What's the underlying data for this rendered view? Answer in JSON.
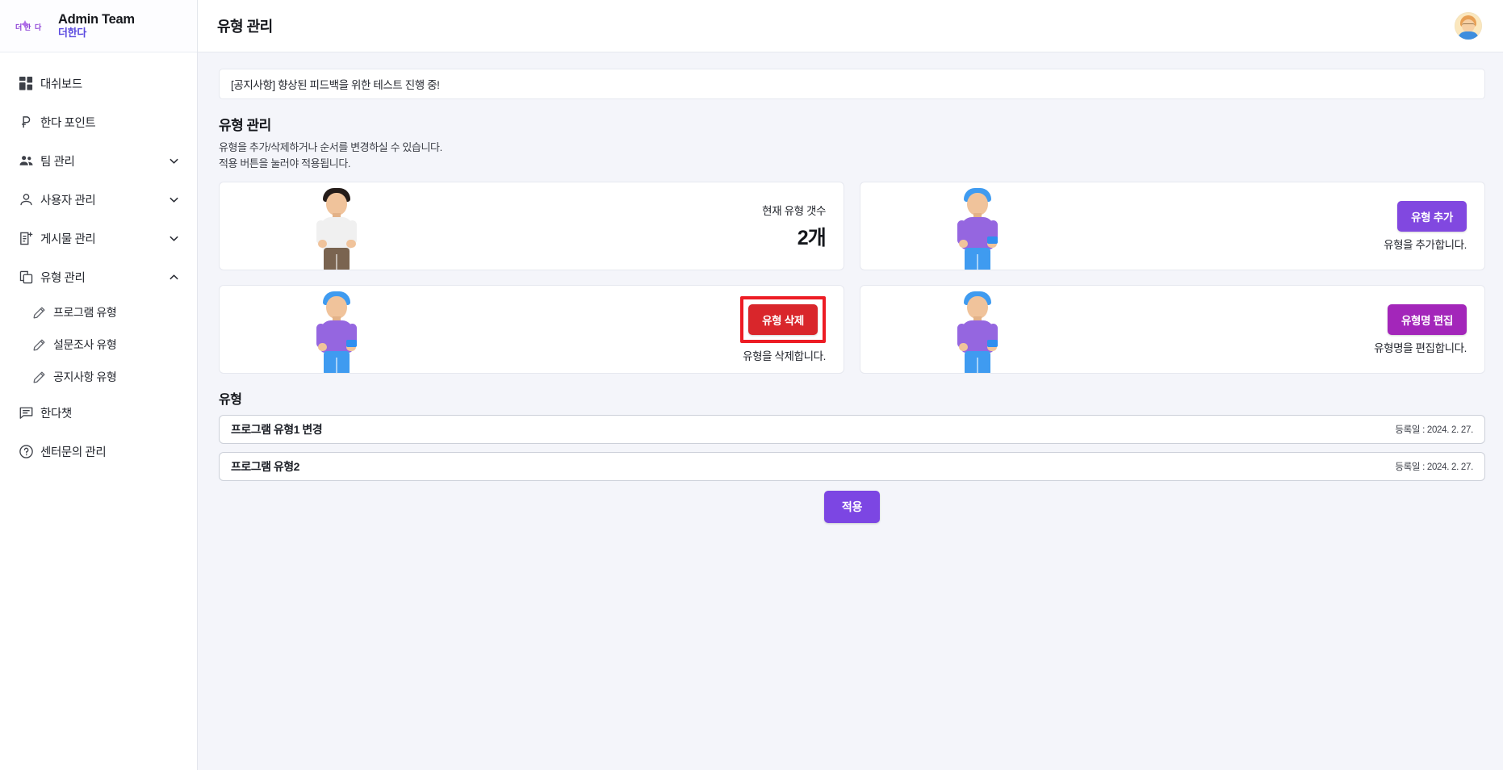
{
  "brand": {
    "logo_text": "더한다",
    "logo_icon": "brand-logo-icon",
    "title": "Admin Team",
    "subtitle": "더한다"
  },
  "sidebar": {
    "items": [
      {
        "label": "대쉬보드",
        "icon": "dashboard-icon",
        "chevron": "",
        "sub": false
      },
      {
        "label": "한다 포인트",
        "icon": "point-icon",
        "chevron": "",
        "sub": false
      },
      {
        "label": "팀 관리",
        "icon": "team-icon",
        "chevron": "chevron-down-icon",
        "sub": false
      },
      {
        "label": "사용자 관리",
        "icon": "user-icon",
        "chevron": "chevron-down-icon",
        "sub": false
      },
      {
        "label": "게시물 관리",
        "icon": "post-icon",
        "chevron": "chevron-down-icon",
        "sub": false
      },
      {
        "label": "유형 관리",
        "icon": "type-icon",
        "chevron": "chevron-up-icon",
        "sub": false
      },
      {
        "label": "프로그램 유형",
        "icon": "pencil-icon",
        "chevron": "",
        "sub": true
      },
      {
        "label": "설문조사 유형",
        "icon": "pencil-icon",
        "chevron": "",
        "sub": true
      },
      {
        "label": "공지사항 유형",
        "icon": "pencil-icon",
        "chevron": "",
        "sub": true
      },
      {
        "label": "한다챗",
        "icon": "chat-icon",
        "chevron": "",
        "sub": false
      },
      {
        "label": "센터문의 관리",
        "icon": "help-icon",
        "chevron": "",
        "sub": false
      }
    ]
  },
  "topbar": {
    "title": "유형 관리",
    "avatar_name": "user-avatar"
  },
  "notice": {
    "text": "[공지사항] 향상된 피드백을 위한 테스트 진행 중!"
  },
  "section": {
    "title": "유형 관리",
    "desc_line1": "유형을 추가/삭제하거나 순서를 변경하실 수 있습니다.",
    "desc_line2": "적용 버튼을 눌러야 적용됩니다."
  },
  "cards": {
    "count_card": {
      "label": "현재 유형 갯수",
      "value": "2개",
      "art": "man-standing-white-shirt"
    },
    "add_card": {
      "button": "유형 추가",
      "caption": "유형을 추가합니다.",
      "art": "man-with-phone-purple-shirt",
      "color": "#8148e0"
    },
    "delete_card": {
      "button": "유형 삭제",
      "caption": "유형을 삭제합니다.",
      "art": "man-with-phone-purple-shirt",
      "color": "#d9262b",
      "highlighted": true,
      "highlight_color": "#ed1c24"
    },
    "edit_card": {
      "button": "유형명 편집",
      "caption": "유형명을 편집합니다.",
      "art": "man-with-phone-purple-shirt",
      "color": "#a326ba"
    }
  },
  "list": {
    "title": "유형",
    "rows": [
      {
        "name": "프로그램 유형1 변경",
        "date": "등록일 : 2024. 2. 27."
      },
      {
        "name": "프로그램 유형2",
        "date": "등록일 : 2024. 2. 27."
      }
    ]
  },
  "apply": {
    "label": "적용",
    "color": "#7c46e3"
  }
}
